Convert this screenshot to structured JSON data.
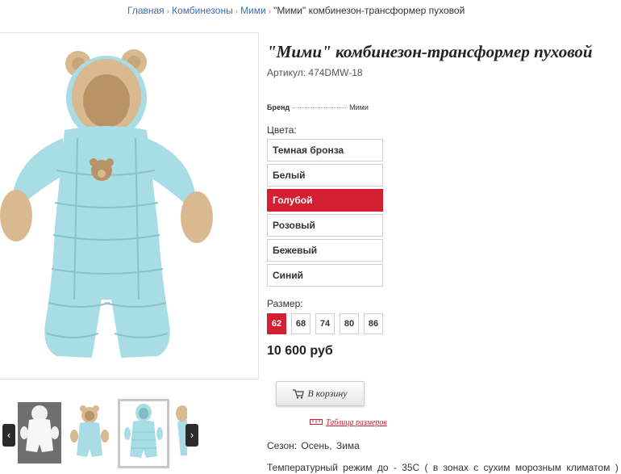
{
  "breadcrumb": {
    "items": [
      "Главная",
      "Комбинезоны",
      "Мими"
    ],
    "current": "\"Мими\" комбинезон-трансформер пуховой"
  },
  "product": {
    "title": "\"Мими\" комбинезон-трансформер пуховой",
    "sku": "Артикул: 474DMW-18",
    "brand_label": "Бренд",
    "brand_value": "Мими",
    "colors_label": "Цвета:",
    "colors": [
      "Темная бронза",
      "Белый",
      "Голубой",
      "Розовый",
      "Бежевый",
      "Синий"
    ],
    "selected_color": "Голубой",
    "size_label": "Размер:",
    "sizes": [
      "62",
      "68",
      "74",
      "80",
      "86"
    ],
    "selected_size": "62",
    "price": "10 600 руб",
    "cart_label": "В корзину",
    "size_table_label": "Таблица размеров",
    "season": "Сезон:  Осень,  Зима",
    "temperature": "Температурный режим до  -  35С ( в зонах  с  сухим морозным климатом )"
  },
  "gallery": {
    "thumbnails": [
      "white-suit",
      "blue-suit-bear",
      "blue-suit-front",
      "partial"
    ],
    "active_thumbnail": 2,
    "prev_arrow": "‹",
    "next_arrow": "›"
  },
  "colors": {
    "accent": "#d21f32",
    "link": "#3a6fb0",
    "suit_blue": "#a9dde6",
    "fur": "#d9b98f"
  }
}
